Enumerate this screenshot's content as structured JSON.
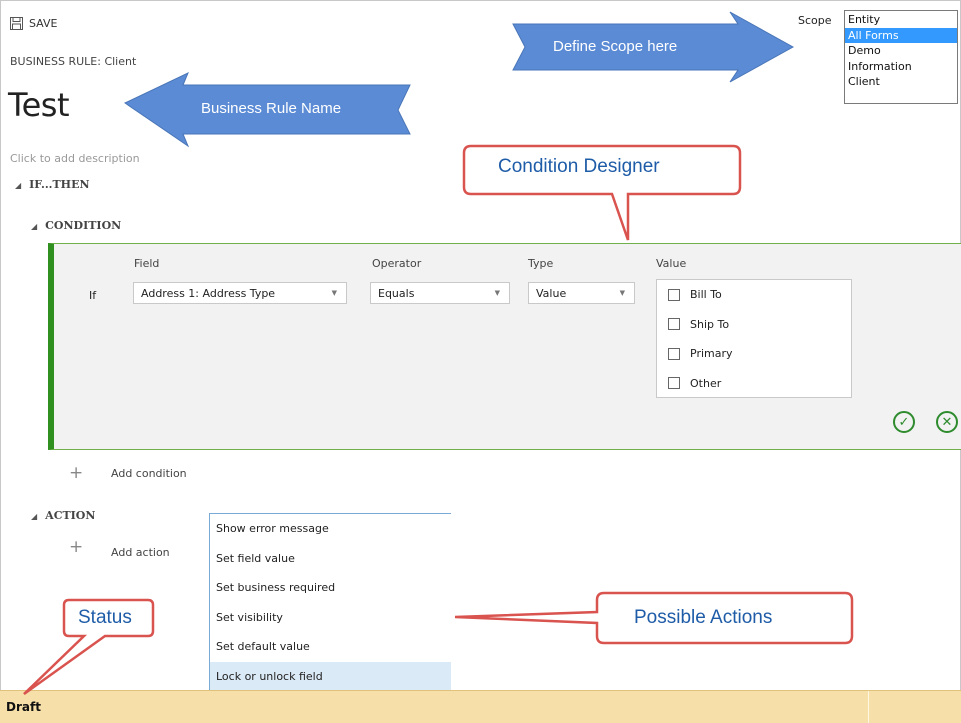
{
  "toolbar": {
    "save_label": "SAVE",
    "save_icon": "save-icon"
  },
  "header": {
    "entity_line": "BUSINESS RULE: Client",
    "rule_name": "Test",
    "description_placeholder": "Click to add description"
  },
  "scope": {
    "label": "Scope",
    "options": [
      "Entity",
      "All Forms",
      "Demo",
      "Information",
      "Client"
    ],
    "selected": "All Forms"
  },
  "sections": {
    "if_then": "IF...THEN",
    "condition": "CONDITION",
    "action": "ACTION"
  },
  "condition": {
    "row_label": "If",
    "columns": {
      "field": "Field",
      "operator": "Operator",
      "type": "Type",
      "value": "Value"
    },
    "field_value": "Address 1: Address Type",
    "operator_value": "Equals",
    "type_value": "Value",
    "value_options": [
      "Bill To",
      "Ship To",
      "Primary",
      "Other"
    ],
    "ok_icon": "checkmark-circle-icon",
    "cancel_icon": "x-circle-icon"
  },
  "links": {
    "add_condition": "Add condition",
    "add_action": "Add action"
  },
  "action_menu": {
    "items": [
      "Show error message",
      "Set field value",
      "Set business required",
      "Set visibility",
      "Set default value",
      "Lock or unlock field"
    ],
    "highlighted": "Lock or unlock field"
  },
  "status": {
    "text": "Draft"
  },
  "annotations": {
    "define_scope": "Define Scope here",
    "business_rule_name": "Business Rule Name",
    "condition_designer": "Condition Designer",
    "status": "Status",
    "possible_actions": "Possible Actions"
  },
  "colors": {
    "condition_border": "#2f8f1f",
    "status_bar": "#f6dfa8",
    "scope_selected": "#3399ff",
    "menu_highlight": "#dbeaf7",
    "arrow_fill": "#5b8bd4",
    "callout_border": "#d9534f"
  }
}
